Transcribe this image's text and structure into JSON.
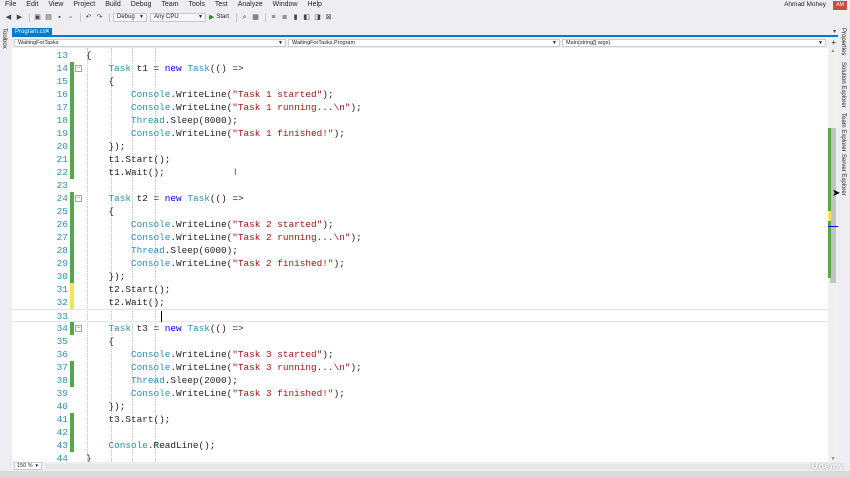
{
  "menu": [
    "File",
    "Edit",
    "View",
    "Project",
    "Build",
    "Debug",
    "Team",
    "Tools",
    "Test",
    "Analyze",
    "Window",
    "Help"
  ],
  "user": {
    "name": "Ahmad Mohey",
    "initials": "AM"
  },
  "toolbar": {
    "configuration": "Debug",
    "platform": "Any CPU",
    "start_label": "Start"
  },
  "sidebar_left": {
    "toolbox_label": "Toolbox"
  },
  "sidebar_right": [
    "Properties",
    "Solution Explorer",
    "Team Explorer",
    "Server Explorer"
  ],
  "tab": {
    "label": "Program.cs*"
  },
  "nav": {
    "project": "WaitingForTasks",
    "type": "WaitingForTasks.Program",
    "member": "Main(string[] args)"
  },
  "editor": {
    "lines": [
      {
        "n": "13",
        "code": "{"
      },
      {
        "n": "14",
        "code": "    Task t1 = new Task(() =>"
      },
      {
        "n": "15",
        "code": "    {"
      },
      {
        "n": "16",
        "code": "        Console.WriteLine(\"Task 1 started\");"
      },
      {
        "n": "17",
        "code": "        Console.WriteLine(\"Task 1 running...\\n\");"
      },
      {
        "n": "18",
        "code": "        Thread.Sleep(8000);"
      },
      {
        "n": "19",
        "code": "        Console.WriteLine(\"Task 1 finished!\");"
      },
      {
        "n": "20",
        "code": "    });"
      },
      {
        "n": "21",
        "code": "    t1.Start();"
      },
      {
        "n": "22",
        "code": "    t1.Wait();"
      },
      {
        "n": "23",
        "code": ""
      },
      {
        "n": "24",
        "code": "    Task t2 = new Task(() =>"
      },
      {
        "n": "25",
        "code": "    {"
      },
      {
        "n": "26",
        "code": "        Console.WriteLine(\"Task 2 started\");"
      },
      {
        "n": "27",
        "code": "        Console.WriteLine(\"Task 2 running...\\n\");"
      },
      {
        "n": "28",
        "code": "        Thread.Sleep(6000);"
      },
      {
        "n": "29",
        "code": "        Console.WriteLine(\"Task 2 finished!\");"
      },
      {
        "n": "30",
        "code": "    });"
      },
      {
        "n": "31",
        "code": "    t2.Start();"
      },
      {
        "n": "32",
        "code": "    t2.Wait();"
      },
      {
        "n": "33",
        "code": ""
      },
      {
        "n": "34",
        "code": "    Task t3 = new Task(() =>"
      },
      {
        "n": "35",
        "code": "    {"
      },
      {
        "n": "36",
        "code": "        Console.WriteLine(\"Task 3 started\");"
      },
      {
        "n": "37",
        "code": "        Console.WriteLine(\"Task 3 running...\\n\");"
      },
      {
        "n": "38",
        "code": "        Thread.Sleep(2000);"
      },
      {
        "n": "39",
        "code": "        Console.WriteLine(\"Task 3 finished!\");"
      },
      {
        "n": "40",
        "code": "    });"
      },
      {
        "n": "41",
        "code": "    t3.Start();"
      },
      {
        "n": "42",
        "code": ""
      },
      {
        "n": "43",
        "code": "    Console.ReadLine();"
      },
      {
        "n": "44",
        "code": "}"
      }
    ],
    "change_marks": {
      "14": "green",
      "15": "green",
      "16": "green",
      "17": "green",
      "18": "green",
      "19": "green",
      "20": "green",
      "21": "green",
      "22": "green",
      "24": "green",
      "25": "green",
      "26": "green",
      "27": "green",
      "28": "green",
      "29": "green",
      "30": "green",
      "31": "yellow",
      "32": "yellow",
      "34": "green",
      "37": "green",
      "38": "green",
      "41": "green",
      "42": "green",
      "43": "green"
    },
    "fold_lines": [
      "14",
      "24",
      "34"
    ],
    "current_line": "33"
  },
  "zoom": "150 %",
  "colors": {
    "accent": "#007acc",
    "keyword": "#0000ff",
    "type": "#2b91af",
    "string": "#a31515",
    "changed_saved": "#57a64a",
    "changed_unsaved": "#efe560"
  },
  "watermark": "Udemy"
}
